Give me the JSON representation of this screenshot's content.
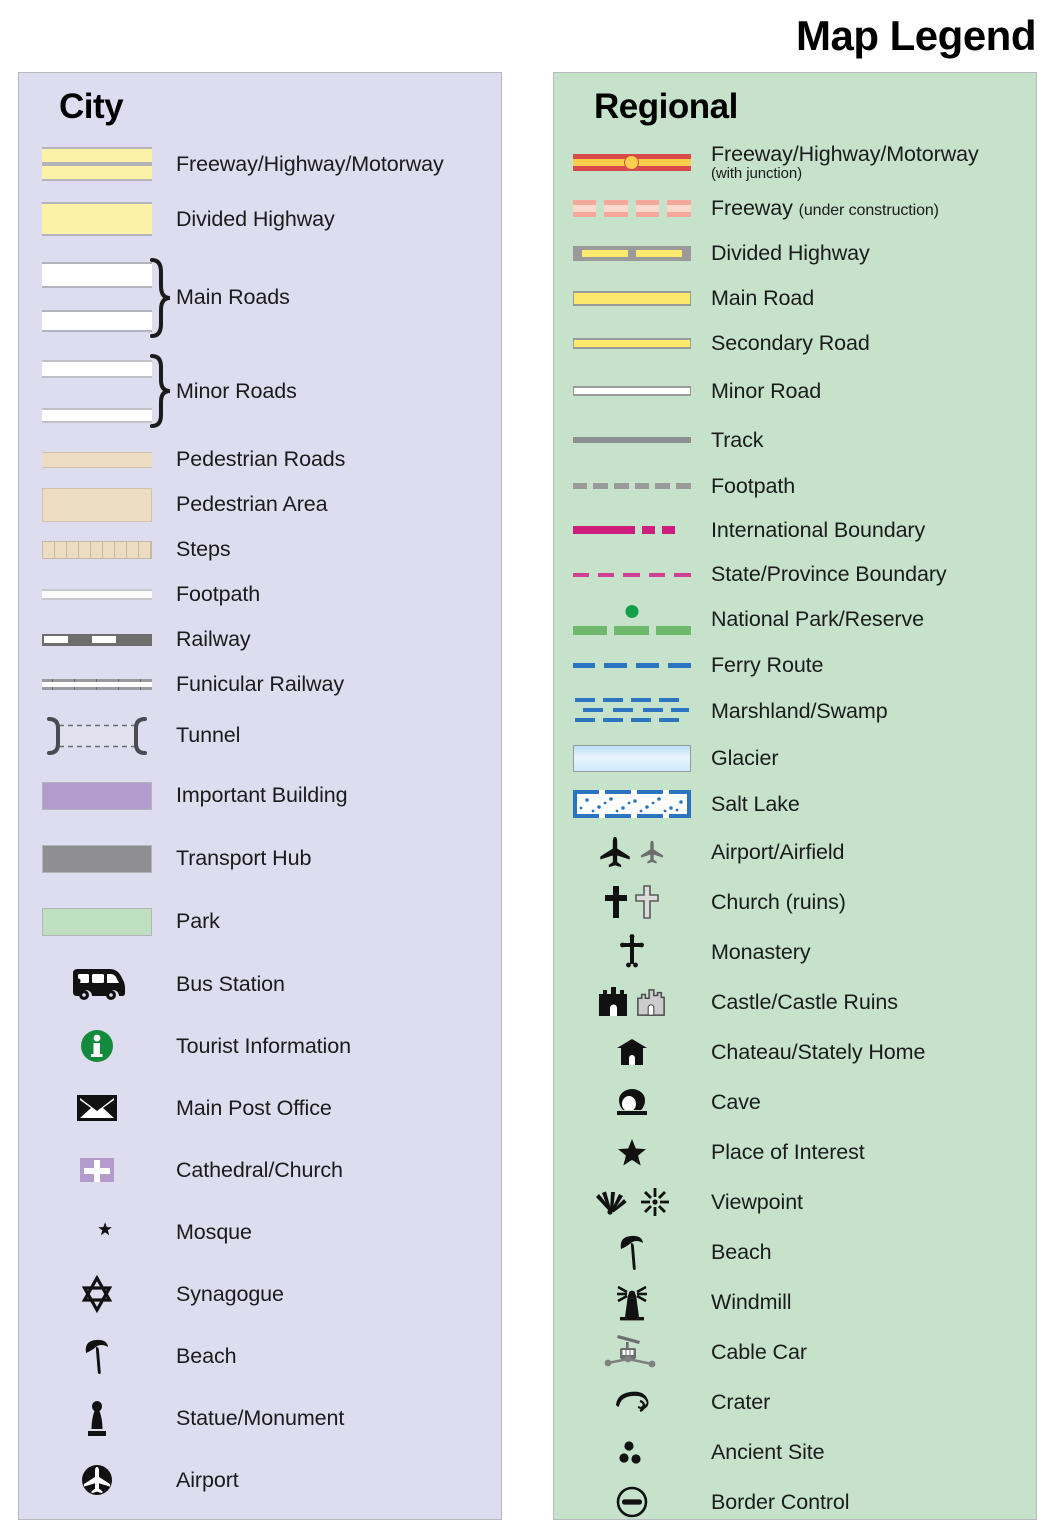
{
  "title": "Map Legend",
  "city": {
    "heading": "City",
    "bg": "#dedcef",
    "items": [
      {
        "label": "Freeway/Highway/Motorway",
        "symbol": "city-freeway-swatch"
      },
      {
        "label": "Divided Highway",
        "symbol": "city-divided-highway-swatch"
      },
      {
        "label": "Main Roads",
        "symbol": "city-main-roads-swatch"
      },
      {
        "label": "Minor Roads",
        "symbol": "city-minor-roads-swatch"
      },
      {
        "label": "Pedestrian Roads",
        "symbol": "city-pedestrian-road-swatch"
      },
      {
        "label": "Pedestrian Area",
        "symbol": "city-pedestrian-area-swatch"
      },
      {
        "label": "Steps",
        "symbol": "city-steps-swatch"
      },
      {
        "label": "Footpath",
        "symbol": "city-footpath-swatch"
      },
      {
        "label": "Railway",
        "symbol": "city-railway-swatch"
      },
      {
        "label": "Funicular Railway",
        "symbol": "city-funicular-swatch"
      },
      {
        "label": "Tunnel",
        "symbol": "city-tunnel-swatch"
      },
      {
        "label": "Important Building",
        "symbol": "city-important-building-swatch"
      },
      {
        "label": "Transport Hub",
        "symbol": "city-transport-hub-swatch"
      },
      {
        "label": "Park",
        "symbol": "city-park-swatch"
      },
      {
        "label": "Bus Station",
        "symbol": "bus-icon"
      },
      {
        "label": "Tourist Information",
        "symbol": "information-icon"
      },
      {
        "label": "Main Post Office",
        "symbol": "envelope-icon"
      },
      {
        "label": "Cathedral/Church",
        "symbol": "church-cross-icon"
      },
      {
        "label": "Mosque",
        "symbol": "crescent-star-icon"
      },
      {
        "label": "Synagogue",
        "symbol": "star-of-david-icon"
      },
      {
        "label": "Beach",
        "symbol": "beach-umbrella-icon"
      },
      {
        "label": "Statue/Monument",
        "symbol": "statue-icon"
      },
      {
        "label": "Airport",
        "symbol": "airport-circle-icon"
      }
    ]
  },
  "regional": {
    "heading": "Regional",
    "bg": "#c6e2cb",
    "items": [
      {
        "label": "Freeway/Highway/Motorway",
        "sub": "(with junction)",
        "symbol": "regional-freeway-junction-swatch"
      },
      {
        "label": "Freeway",
        "inline_sub": "(under construction)",
        "symbol": "regional-freeway-construction-swatch"
      },
      {
        "label": "Divided Highway",
        "symbol": "regional-divided-highway-swatch"
      },
      {
        "label": "Main Road",
        "symbol": "regional-main-road-swatch"
      },
      {
        "label": "Secondary Road",
        "symbol": "regional-secondary-road-swatch"
      },
      {
        "label": "Minor Road",
        "symbol": "regional-minor-road-swatch"
      },
      {
        "label": "Track",
        "symbol": "regional-track-swatch"
      },
      {
        "label": "Footpath",
        "symbol": "regional-footpath-swatch"
      },
      {
        "label": "International Boundary",
        "symbol": "international-boundary-swatch"
      },
      {
        "label": "State/Province Boundary",
        "symbol": "state-boundary-swatch"
      },
      {
        "label": "National Park/Reserve",
        "symbol": "national-park-swatch"
      },
      {
        "label": "Ferry Route",
        "symbol": "ferry-route-swatch"
      },
      {
        "label": "Marshland/Swamp",
        "symbol": "marshland-swatch"
      },
      {
        "label": "Glacier",
        "symbol": "glacier-swatch"
      },
      {
        "label": "Salt Lake",
        "symbol": "salt-lake-swatch"
      },
      {
        "label": "Airport/Airfield",
        "symbol": "airplane-icon"
      },
      {
        "label": "Church (ruins)",
        "symbol": "cross-icon"
      },
      {
        "label": "Monastery",
        "symbol": "monastery-cross-icon"
      },
      {
        "label": "Castle/Castle Ruins",
        "symbol": "castle-icon"
      },
      {
        "label": "Chateau/Stately Home",
        "symbol": "chateau-icon"
      },
      {
        "label": "Cave",
        "symbol": "cave-icon"
      },
      {
        "label": "Place of Interest",
        "symbol": "star-icon"
      },
      {
        "label": "Viewpoint",
        "symbol": "viewpoint-icon"
      },
      {
        "label": "Beach",
        "symbol": "beach-umbrella-icon"
      },
      {
        "label": "Windmill",
        "symbol": "windmill-icon"
      },
      {
        "label": "Cable Car",
        "symbol": "cable-car-icon"
      },
      {
        "label": "Crater",
        "symbol": "crater-icon"
      },
      {
        "label": "Ancient Site",
        "symbol": "ancient-site-icon"
      },
      {
        "label": "Border Control",
        "symbol": "border-control-icon"
      }
    ]
  },
  "colors": {
    "city_panel": "#dedcef",
    "regional_panel": "#c6e2cb",
    "highway_yellow": "#fbf2a8",
    "road_yellow": "#fbe96d",
    "freeway_red": "#d8494a",
    "junction_orange": "#f9cf4d",
    "construction_pink": "#f5a79c",
    "boundary_magenta": "#cf1f7e",
    "park_green": "#6fb96f",
    "ferry_blue": "#2c74c0",
    "pedestrian_tan": "#ecdcc2",
    "important_building_purple": "#b39bcd",
    "transport_hub_gray": "#8f8f92",
    "city_park_green": "#bfdfc1",
    "tourist_info_green": "#148a3d"
  }
}
